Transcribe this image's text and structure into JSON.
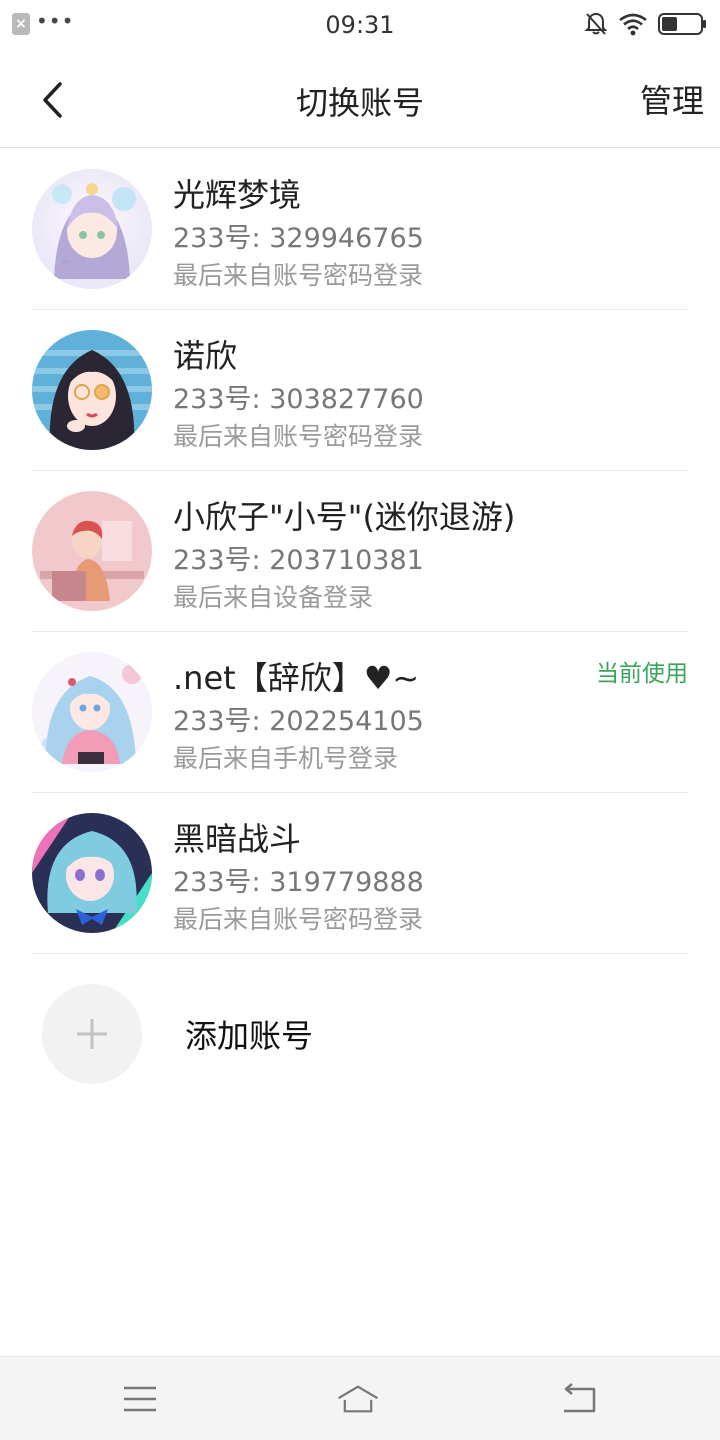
{
  "status_bar": {
    "time": "09:31",
    "notification_icon": "app-notification-icon",
    "more_dots": "•••"
  },
  "header": {
    "title": "切换账号",
    "back_icon": "chevron-left-icon",
    "manage_label": "管理"
  },
  "accounts": [
    {
      "name": "光辉梦境",
      "id": "233号: 329946765",
      "login": "最后来自账号密码登录",
      "current": ""
    },
    {
      "name": "诺欣",
      "id": "233号: 303827760",
      "login": "最后来自账号密码登录",
      "current": ""
    },
    {
      "name": "小欣子\"小号\"(迷你退游)",
      "id": "233号: 203710381",
      "login": "最后来自设备登录",
      "current": ""
    },
    {
      "name": ".net【辞欣】♥~",
      "id": "233号: 202254105",
      "login": "最后来自手机号登录",
      "current": "当前使用"
    },
    {
      "name": "黑暗战斗",
      "id": "233号: 319779888",
      "login": "最后来自账号密码登录",
      "current": ""
    }
  ],
  "add_account": {
    "label": "添加账号",
    "icon": "plus-icon"
  },
  "colors": {
    "current_badge": "#3aa55a",
    "nav_background": "#f4f4f4"
  }
}
